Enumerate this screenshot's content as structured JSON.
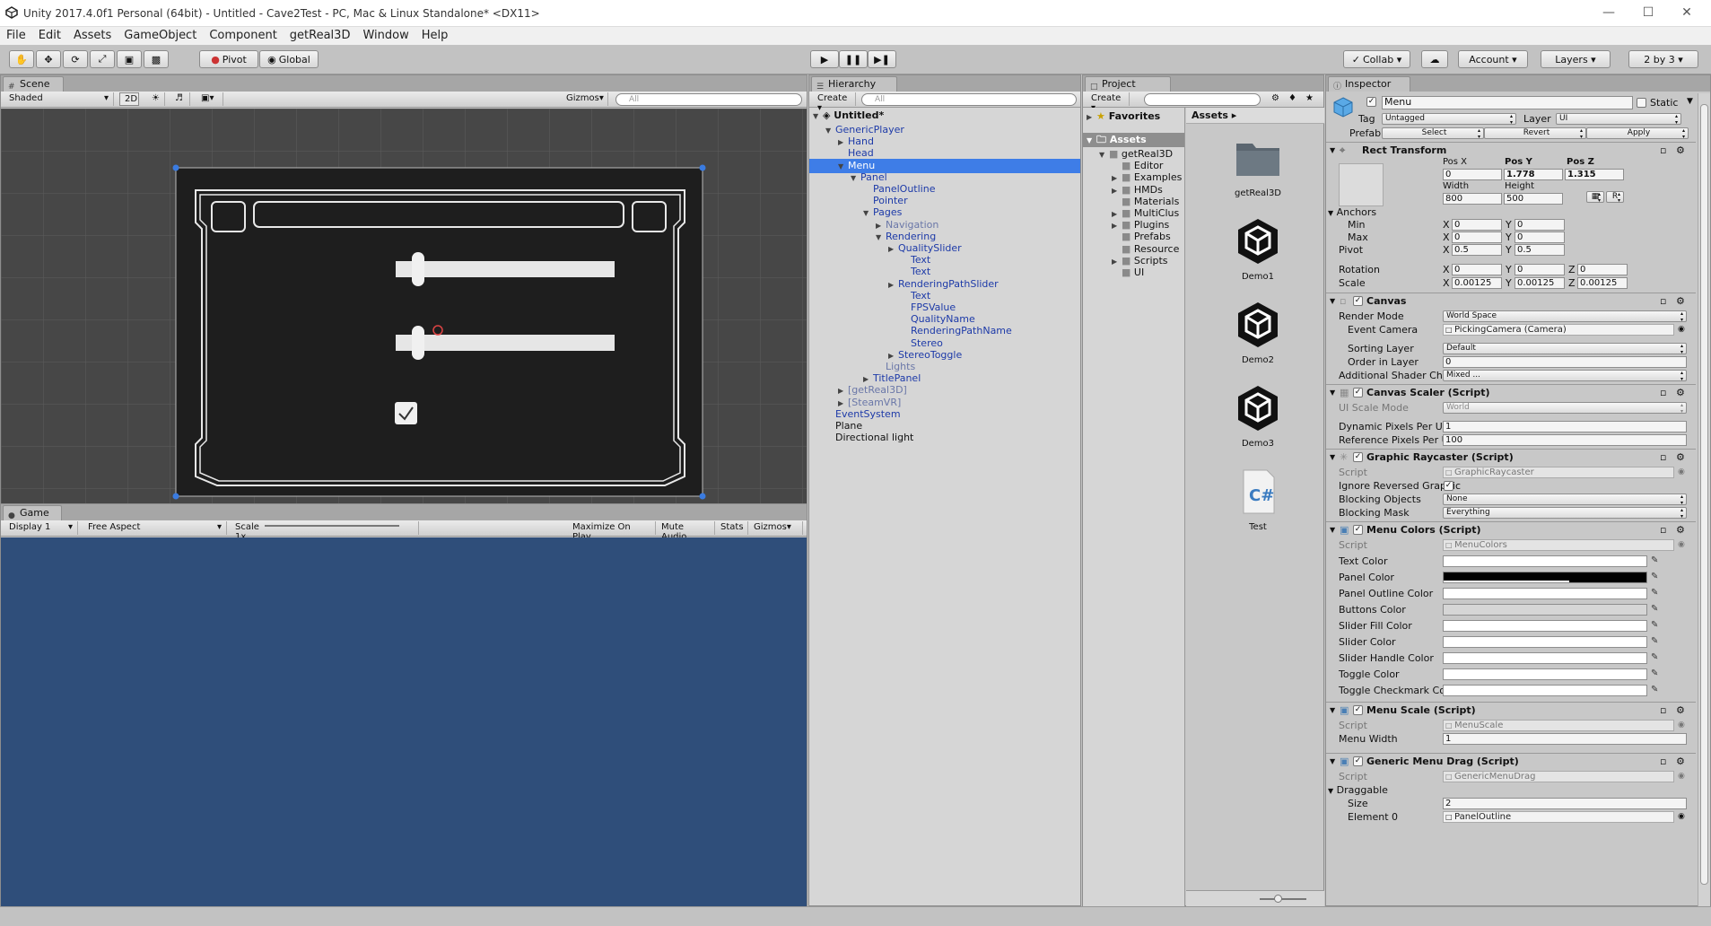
{
  "window": {
    "title": "Unity 2017.4.0f1 Personal (64bit) - Untitled - Cave2Test - PC, Mac & Linux Standalone* <DX11>"
  },
  "menu": [
    "File",
    "Edit",
    "Assets",
    "GameObject",
    "Component",
    "getReal3D",
    "Window",
    "Help"
  ],
  "toolbar": {
    "pivot": "Pivot",
    "global": "Global",
    "collab": "Collab ▾",
    "account": "Account",
    "layers": "Layers",
    "layout": "2 by 3"
  },
  "scene": {
    "tab": "Scene",
    "shading": "Shaded",
    "mode2d": "2D",
    "gizmos": "Gizmos",
    "search_placeholder": "All"
  },
  "game": {
    "tab": "Game",
    "display": "Display 1",
    "aspect": "Free Aspect",
    "scale_label": "Scale",
    "scale_value": "1x",
    "maximize": "Maximize On Play",
    "mute": "Mute Audio",
    "stats": "Stats",
    "gizmos": "Gizmos",
    "bg_color": "#2f4e7a"
  },
  "hierarchy": {
    "tab": "Hierarchy",
    "create": "Create",
    "search_placeholder": "All",
    "scene_name": "Untitled*",
    "items": [
      {
        "label": "GenericPlayer",
        "arrow": "▼",
        "style": "blue"
      },
      {
        "label": "Hand",
        "arrow": "▶",
        "style": "blue"
      },
      {
        "label": "Head",
        "arrow": "",
        "style": "blue"
      },
      {
        "label": "Menu",
        "arrow": "▼",
        "style": "sel"
      },
      {
        "label": "Panel",
        "arrow": "▼",
        "style": "blue"
      },
      {
        "label": "PanelOutline",
        "arrow": "",
        "style": "blue"
      },
      {
        "label": "Pointer",
        "arrow": "",
        "style": "blue"
      },
      {
        "label": "Pages",
        "arrow": "▼",
        "style": "blue"
      },
      {
        "label": "Navigation",
        "arrow": "▶",
        "style": "grey"
      },
      {
        "label": "Rendering",
        "arrow": "▼",
        "style": "blue"
      },
      {
        "label": "QualitySlider",
        "arrow": "▶",
        "style": "blue"
      },
      {
        "label": "Text",
        "arrow": "",
        "style": "blue"
      },
      {
        "label": "Text",
        "arrow": "",
        "style": "blue"
      },
      {
        "label": "RenderingPathSlider",
        "arrow": "▶",
        "style": "blue"
      },
      {
        "label": "Text",
        "arrow": "",
        "style": "blue"
      },
      {
        "label": "FPSValue",
        "arrow": "",
        "style": "blue"
      },
      {
        "label": "QualityName",
        "arrow": "",
        "style": "blue"
      },
      {
        "label": "RenderingPathName",
        "arrow": "",
        "style": "blue"
      },
      {
        "label": "Stereo",
        "arrow": "",
        "style": "blue"
      },
      {
        "label": "StereoToggle",
        "arrow": "▶",
        "style": "blue"
      },
      {
        "label": "Lights",
        "arrow": "",
        "style": "grey"
      },
      {
        "label": "TitlePanel",
        "arrow": "▶",
        "style": "blue"
      },
      {
        "label": "[getReal3D]",
        "arrow": "▶",
        "style": "grey"
      },
      {
        "label": "[SteamVR]",
        "arrow": "▶",
        "style": "grey"
      },
      {
        "label": "EventSystem",
        "arrow": "",
        "style": "blue"
      },
      {
        "label": "Plane",
        "arrow": "",
        "style": "black"
      },
      {
        "label": "Directional light",
        "arrow": "",
        "style": "black"
      }
    ]
  },
  "project": {
    "tab": "Project",
    "create": "Create",
    "favorites": "Favorites",
    "assets_header": "Assets",
    "tree_root": "Assets",
    "tree": [
      "getReal3D",
      "Editor",
      "Examples",
      "HMDs",
      "Materials",
      "MultiClus",
      "Plugins",
      "Prefabs",
      "Resource",
      "Scripts",
      "UI"
    ],
    "assets": [
      {
        "name": "getReal3D",
        "kind": "folder"
      },
      {
        "name": "Demo1",
        "kind": "unity"
      },
      {
        "name": "Demo2",
        "kind": "unity"
      },
      {
        "name": "Demo3",
        "kind": "unity"
      },
      {
        "name": "Test",
        "kind": "script"
      }
    ]
  },
  "inspector": {
    "tab": "Inspector",
    "object_name": "Menu",
    "static_label": "Static",
    "tag_label": "Tag",
    "tag_value": "Untagged",
    "layer_label": "Layer",
    "layer_value": "UI",
    "prefab_label": "Prefab",
    "prefab_select": "Select",
    "prefab_revert": "Revert",
    "prefab_apply": "Apply",
    "rect": {
      "title": "Rect Transform",
      "posx_label": "Pos X",
      "posy_label": "Pos Y",
      "posz_label": "Pos Z",
      "posx": "0",
      "posy": "1.778",
      "posz": "1.315",
      "width_label": "Width",
      "height_label": "Height",
      "width": "800",
      "height": "500",
      "anchors": "Anchors",
      "min": "Min",
      "max": "Max",
      "pivot": "Pivot",
      "min_x": "0",
      "min_y": "0",
      "max_x": "0",
      "max_y": "0",
      "pivot_x": "0.5",
      "pivot_y": "0.5",
      "rotation": "Rotation",
      "rot_x": "0",
      "rot_y": "0",
      "rot_z": "0",
      "scale": "Scale",
      "scale_x": "0.00125",
      "scale_y": "0.00125",
      "scale_z": "0.00125",
      "r_button": "R"
    },
    "canvas": {
      "title": "Canvas",
      "render_mode_label": "Render Mode",
      "render_mode": "World Space",
      "event_camera_label": "Event Camera",
      "event_camera": "PickingCamera (Camera)",
      "sorting_layer_label": "Sorting Layer",
      "sorting_layer": "Default",
      "order_label": "Order in Layer",
      "order": "0",
      "shader_label": "Additional Shader Chann",
      "shader": "Mixed ..."
    },
    "scaler": {
      "title": "Canvas Scaler (Script)",
      "mode_label": "UI Scale Mode",
      "mode": "World",
      "dpu_label": "Dynamic Pixels Per Unit",
      "dpu": "1",
      "rpu_label": "Reference Pixels Per Unit",
      "rpu": "100"
    },
    "raycaster": {
      "title": "Graphic Raycaster (Script)",
      "script_label": "Script",
      "script": "GraphicRaycaster",
      "ignore_label": "Ignore Reversed Graphic",
      "blocking_label": "Blocking Objects",
      "blocking": "None",
      "mask_label": "Blocking Mask",
      "mask": "Everything"
    },
    "colors": {
      "title": "Menu Colors (Script)",
      "script_label": "Script",
      "script": "MenuColors",
      "rows": [
        {
          "label": "Text Color",
          "color": "#ffffff"
        },
        {
          "label": "Panel Color",
          "color": "#000000"
        },
        {
          "label": "Panel Outline Color",
          "color": "#ffffff"
        },
        {
          "label": "Buttons Color",
          "color": "#d6d6d6"
        },
        {
          "label": "Slider Fill Color",
          "color": "#ffffff"
        },
        {
          "label": "Slider Color",
          "color": "#ffffff"
        },
        {
          "label": "Slider Handle Color",
          "color": "#ffffff"
        },
        {
          "label": "Toggle Color",
          "color": "#ffffff"
        },
        {
          "label": "Toggle Checkmark Color",
          "color": "#ffffff"
        }
      ]
    },
    "scale": {
      "title": "Menu Scale (Script)",
      "script_label": "Script",
      "script": "MenuScale",
      "width_label": "Menu Width",
      "width": "1"
    },
    "drag": {
      "title": "Generic Menu Drag (Script)",
      "script_label": "Script",
      "script": "GenericMenuDrag",
      "draggable": "Draggable",
      "size_label": "Size",
      "size": "2",
      "element_label": "Element 0",
      "element": "PanelOutline"
    }
  }
}
